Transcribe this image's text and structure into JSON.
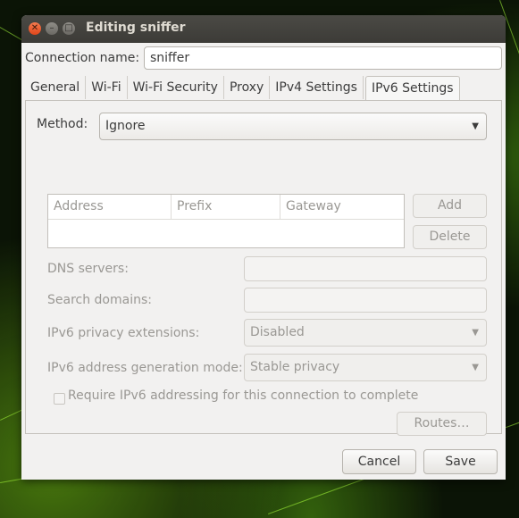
{
  "window": {
    "title": "Editing sniffer"
  },
  "connection": {
    "label": "Connection name:",
    "value": "sniffer"
  },
  "tabs": [
    {
      "label": "General"
    },
    {
      "label": "Wi-Fi"
    },
    {
      "label": "Wi-Fi Security"
    },
    {
      "label": "Proxy"
    },
    {
      "label": "IPv4 Settings"
    },
    {
      "label": "IPv6 Settings",
      "active": true
    }
  ],
  "ipv6": {
    "method_label": "Method:",
    "method_value": "Ignore",
    "table_headers": [
      "Address",
      "Prefix",
      "Gateway"
    ],
    "add_label": "Add",
    "delete_label": "Delete",
    "dns_label": "DNS servers:",
    "search_label": "Search domains:",
    "privacy_label": "IPv6 privacy extensions:",
    "privacy_value": "Disabled",
    "addrgen_label": "IPv6 address generation mode:",
    "addrgen_value": "Stable privacy",
    "require_label": "Require IPv6 addressing for this connection to complete",
    "routes_label": "Routes…"
  },
  "footer": {
    "cancel_label": "Cancel",
    "save_label": "Save"
  }
}
